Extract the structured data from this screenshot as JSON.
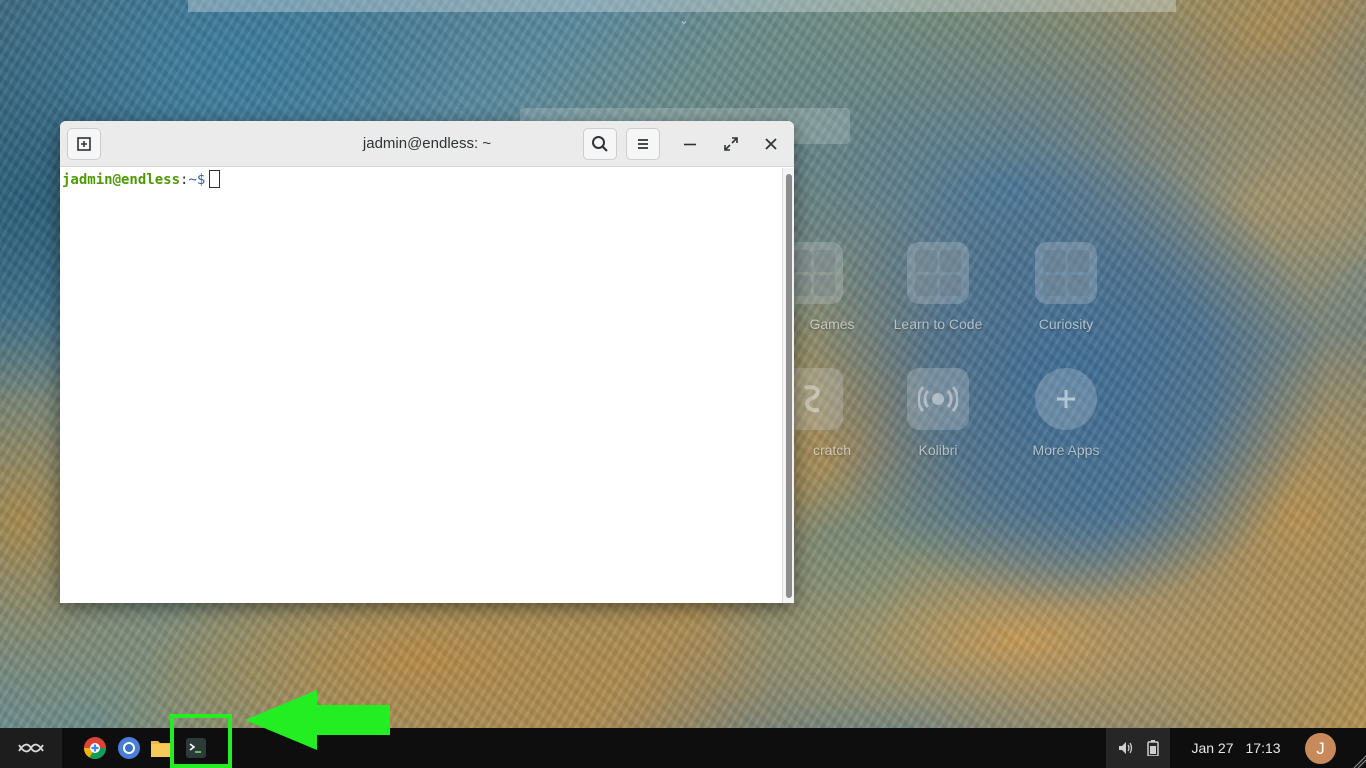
{
  "desktop": {
    "apps": [
      {
        "name": "Games",
        "label": "Games",
        "icon": "folder-icon"
      },
      {
        "name": "Learn to Code",
        "label": "Learn to Code",
        "icon": "folder-icon"
      },
      {
        "name": "Curiosity",
        "label": "Curiosity",
        "icon": "folder-icon"
      },
      {
        "name": "Scratch",
        "label": "Scratch",
        "icon": "scratch-icon"
      },
      {
        "name": "Kolibri",
        "label": "Kolibri",
        "icon": "kolibri-icon"
      },
      {
        "name": "More Apps",
        "label": "More Apps",
        "icon": "add-icon"
      }
    ],
    "visible_text": {
      "games_partial": "Games",
      "scratch_partial": "cratch"
    }
  },
  "terminal": {
    "title": "jadmin@endless: ~",
    "prompt_user": "jadmin@endless",
    "prompt_sep": ":",
    "prompt_path": "~$",
    "icons": {
      "new_tab": "new-tab-icon",
      "search": "search-icon",
      "menu": "hamburger-menu-icon",
      "minimize": "minimize-icon",
      "maximize": "maximize-icon",
      "close": "close-icon"
    }
  },
  "taskbar": {
    "apps": [
      "Chrome",
      "Chromium",
      "Files",
      "Terminal"
    ],
    "clock_date": "Jan 27",
    "clock_time": "17:13",
    "user_initial": "J"
  },
  "annotation": {
    "color": "#22ee22",
    "target": "terminal-taskbar-icon"
  }
}
